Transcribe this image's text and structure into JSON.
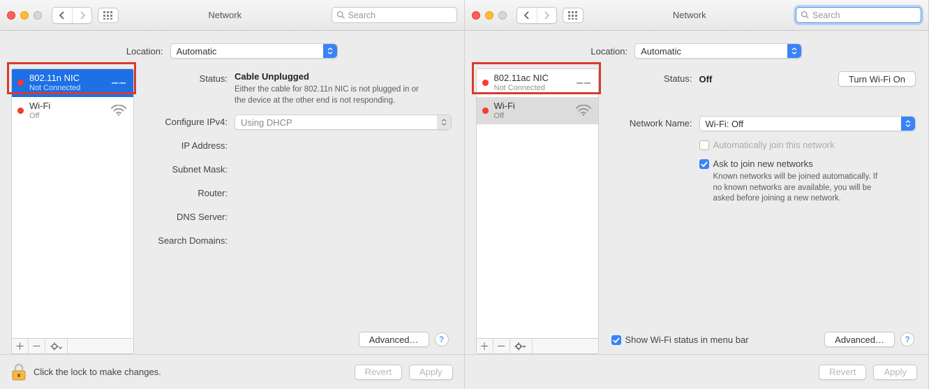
{
  "left": {
    "title": "Network",
    "search_placeholder": "Search",
    "location_label": "Location:",
    "location_value": "Automatic",
    "services": [
      {
        "name": "802.11n NIC",
        "sub": "Not Connected",
        "kind": "ethernet",
        "selected": true
      },
      {
        "name": "Wi-Fi",
        "sub": "Off",
        "kind": "wifi",
        "selected": false
      }
    ],
    "status_label": "Status:",
    "status_value": "Cable Unplugged",
    "status_hint": "Either the cable for 802.11n NIC is not plugged in or the device at the other end is not responding.",
    "configure_label": "Configure IPv4:",
    "configure_value": "Using DHCP",
    "rows": {
      "ip": "IP Address:",
      "mask": "Subnet Mask:",
      "router": "Router:",
      "dns": "DNS Server:",
      "search": "Search Domains:"
    },
    "advanced": "Advanced…",
    "lock_msg": "Click the lock to make changes.",
    "revert": "Revert",
    "apply": "Apply"
  },
  "right": {
    "title": "Network",
    "search_placeholder": "Search",
    "location_label": "Location:",
    "location_value": "Automatic",
    "services": [
      {
        "name": "802.11ac NIC",
        "sub": "Not Connected",
        "kind": "ethernet",
        "selected": false
      },
      {
        "name": "Wi-Fi",
        "sub": "Off",
        "kind": "wifi",
        "selected": true
      }
    ],
    "status_label": "Status:",
    "status_value": "Off",
    "turn_on": "Turn Wi-Fi On",
    "netname_label": "Network Name:",
    "netname_value": "Wi-Fi: Off",
    "auto_join": "Automatically join this network",
    "ask_join": "Ask to join new networks",
    "ask_hint": "Known networks will be joined automatically. If no known networks are available, you will be asked before joining a new network.",
    "show_status": "Show Wi-Fi status in menu bar",
    "advanced": "Advanced…",
    "revert": "Revert",
    "apply": "Apply"
  }
}
